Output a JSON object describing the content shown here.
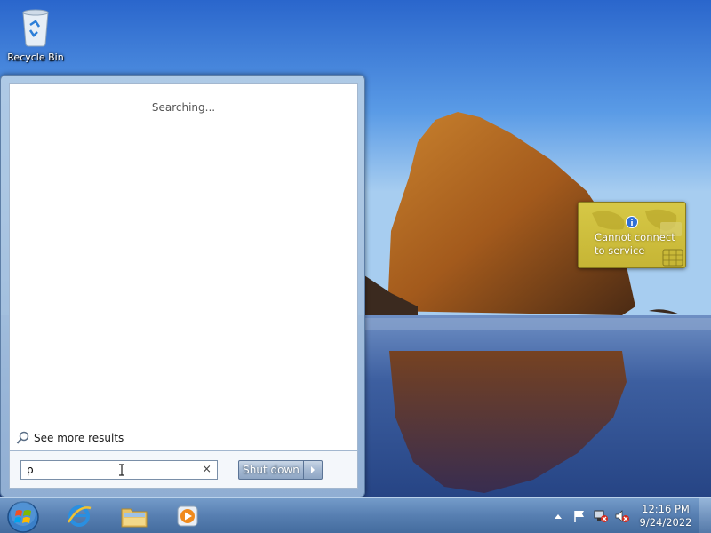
{
  "desktop": {
    "icons": [
      {
        "label": "Recycle Bin",
        "icon": "recycle-bin-icon"
      }
    ]
  },
  "start_menu": {
    "status_text": "Searching...",
    "see_more_label": "See more results",
    "search": {
      "value": "p"
    },
    "shutdown_label": "Shut down"
  },
  "balloon": {
    "message": "Cannot connect to service",
    "icon": "info-icon"
  },
  "taskbar": {
    "pinned": [
      {
        "name": "internet-explorer",
        "icon": "ie-icon"
      },
      {
        "name": "windows-explorer",
        "icon": "folder-icon"
      },
      {
        "name": "media-player",
        "icon": "media-player-icon"
      }
    ],
    "tray": {
      "icons": [
        "show-hidden-icons-arrow",
        "action-center-flag-icon",
        "network-error-icon",
        "volume-muted-icon"
      ],
      "time": "12:16 PM",
      "date": "9/24/2022"
    }
  },
  "colors": {
    "balloon": "#c6b535",
    "taskbar": "#5a82b4",
    "sky": "#2e6fd1"
  }
}
